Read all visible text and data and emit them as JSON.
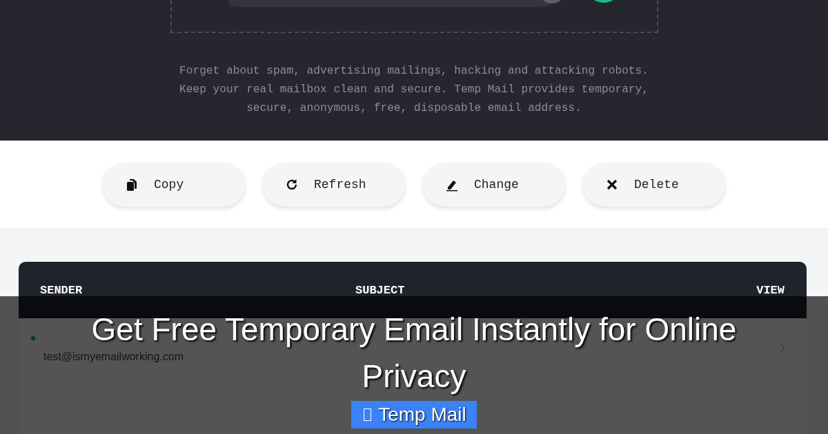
{
  "hero": {
    "description": "Forget about spam, advertising mailings, hacking and attacking robots. Keep your real mailbox clean and secure. Temp Mail provides temporary, secure, anonymous, free, disposable email address."
  },
  "actions": [
    {
      "label": "Copy"
    },
    {
      "label": "Refresh"
    },
    {
      "label": "Change"
    },
    {
      "label": "Delete"
    }
  ],
  "inbox": {
    "columns": [
      "SENDER",
      "SUBJECT",
      "VIEW"
    ],
    "rows": [
      {
        "sender_email": "test@ismyemailworking.com"
      }
    ]
  },
  "overlay": {
    "title_lines": [
      "Get Free Temporary Email Instantly for Online",
      "Privacy"
    ],
    "tag": "Temp Mail"
  }
}
